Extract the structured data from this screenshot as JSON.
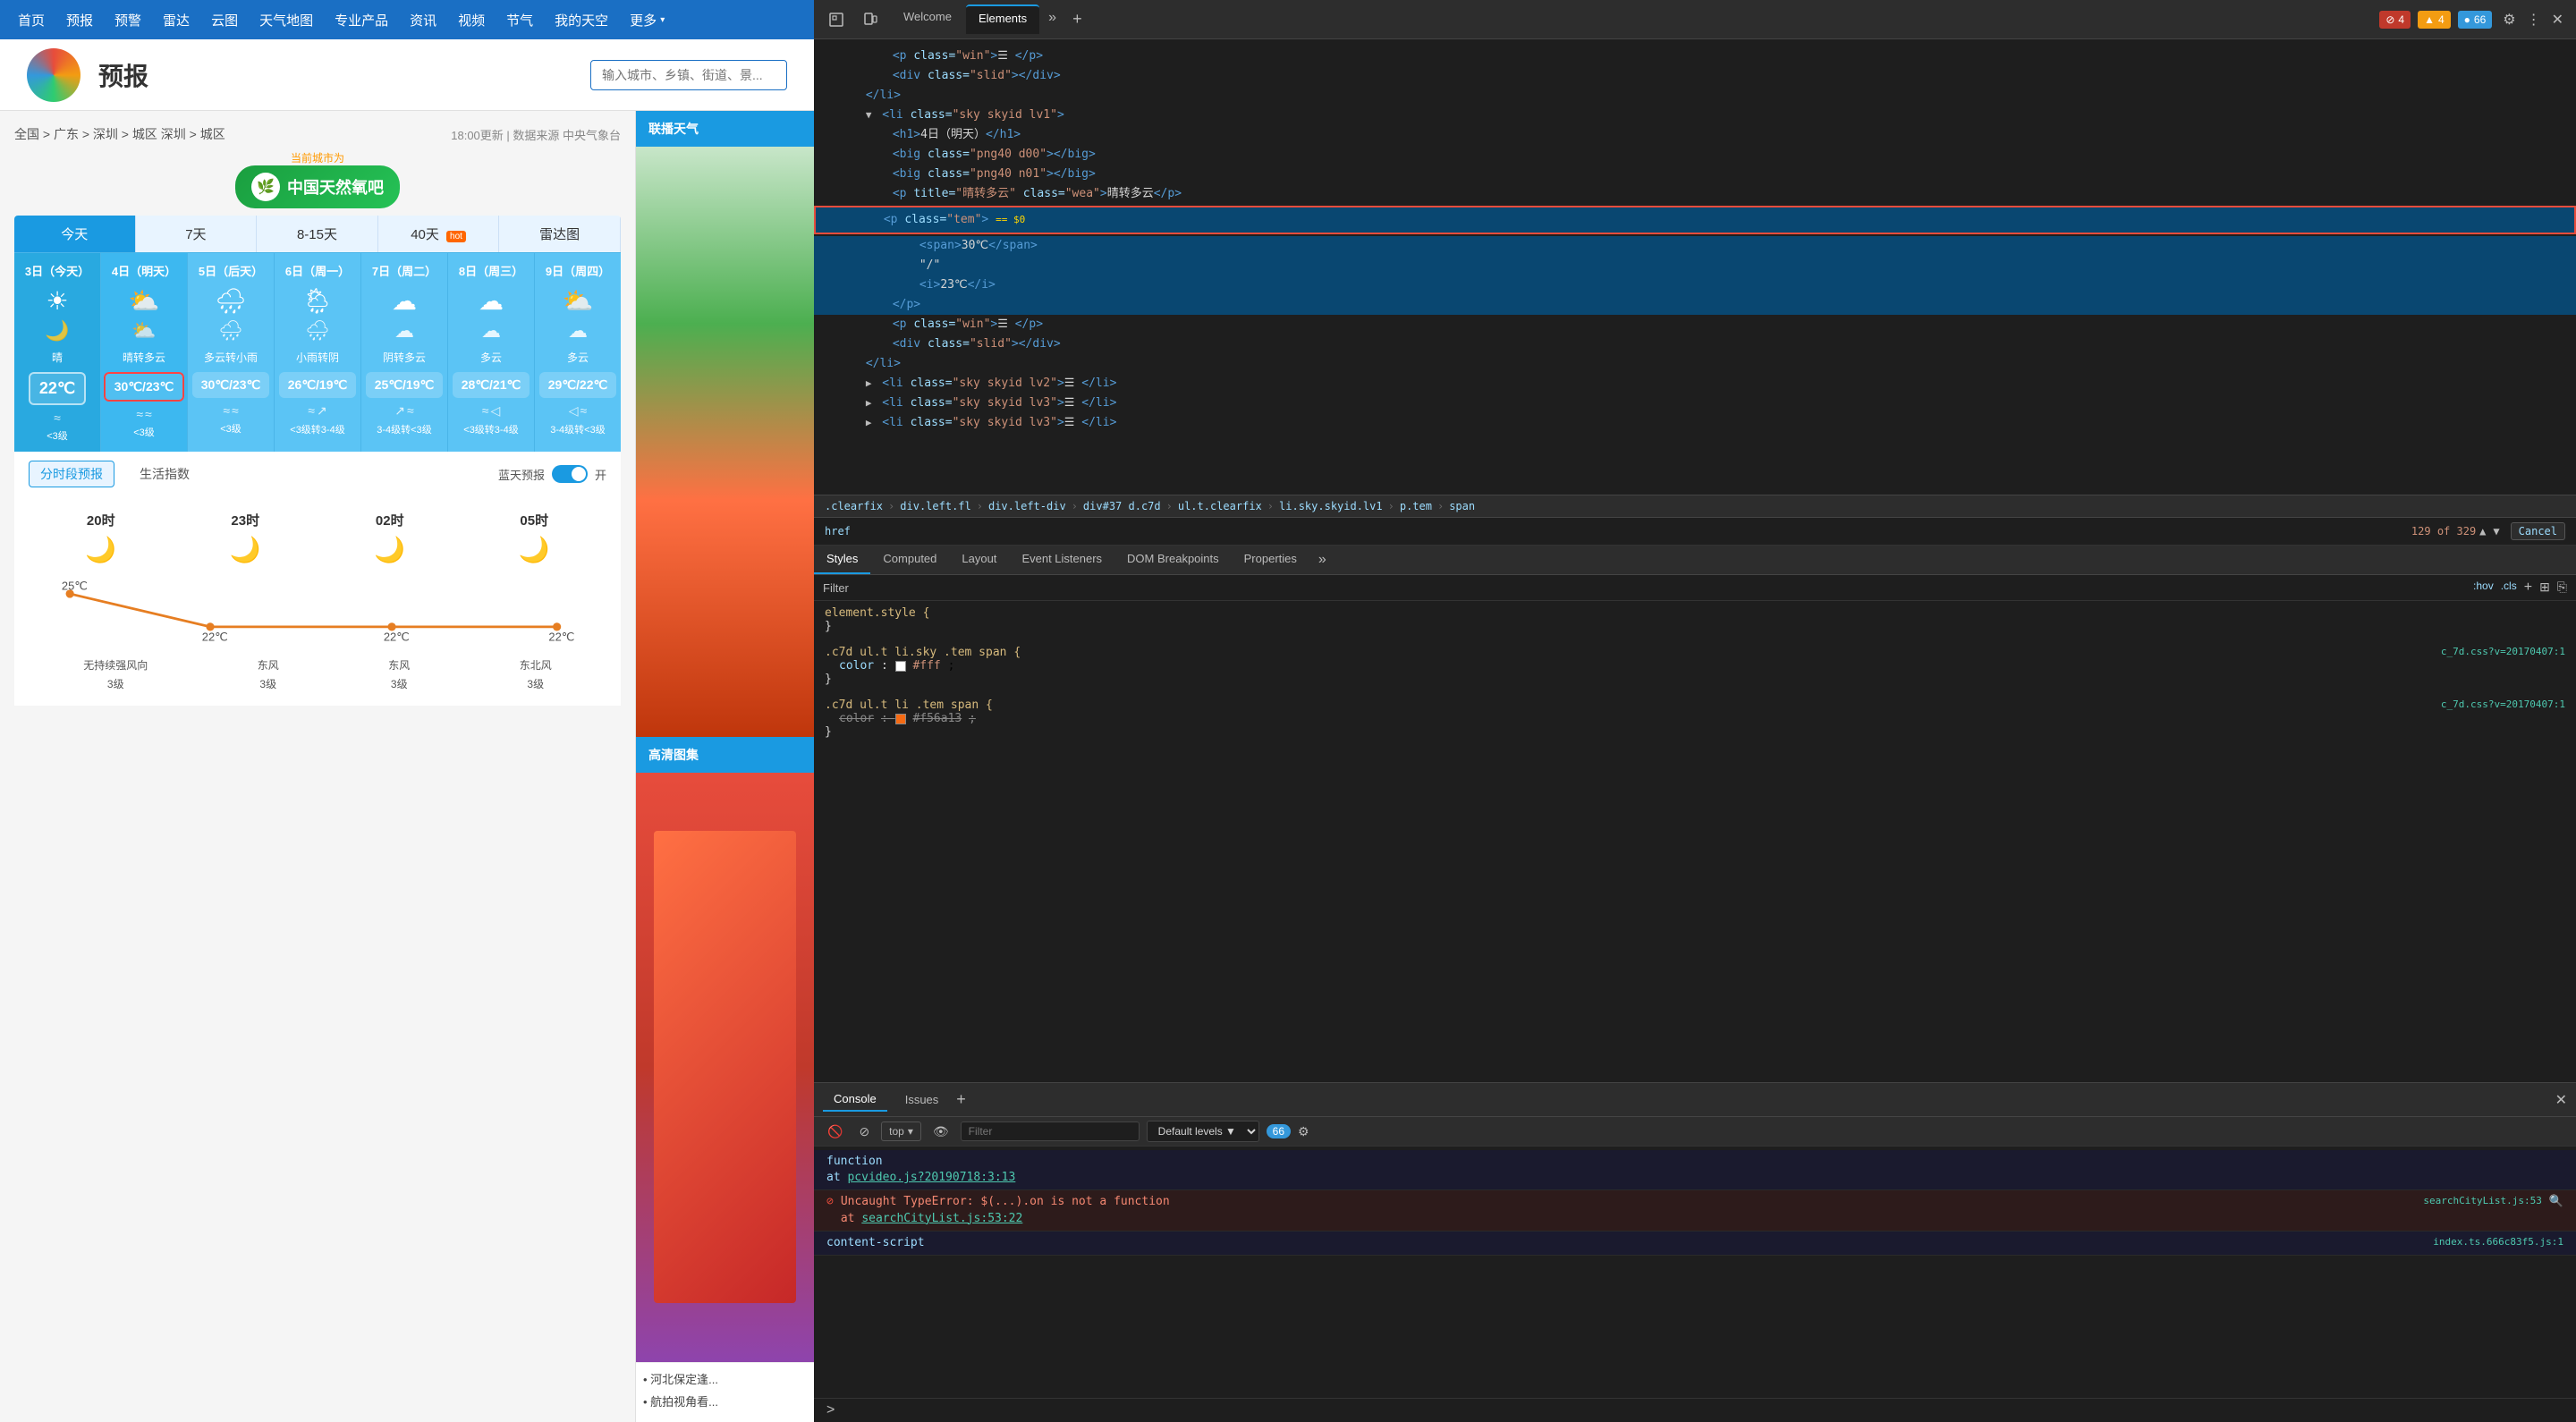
{
  "weather": {
    "nav": {
      "items": [
        "首页",
        "预报",
        "预警",
        "雷达",
        "云图",
        "天气地图",
        "专业产品",
        "资讯",
        "视频",
        "节气",
        "我的天空",
        "更多"
      ]
    },
    "header": {
      "title": "预报",
      "search_placeholder": "输入城市、乡镇、街道、景..."
    },
    "meta": {
      "breadcrumb": "全国 > 广东 > 深圳 > 城区 深圳 > 城区",
      "update_time": "18:00更新 | 数据来源 中央气象台",
      "city_label": "当前城市为",
      "city_name": "中国天然氧吧"
    },
    "tabs": [
      "今天",
      "7天",
      "8-15天",
      "40天 HOT",
      "雷达图"
    ],
    "forecast_days": [
      {
        "date": "3日（今天）",
        "day_icon": "☀",
        "night_icon": "🌙",
        "desc": "晴",
        "temp": "22℃",
        "wind_icons": [
          "≈"
        ],
        "wind_level": "<3级",
        "is_today": true
      },
      {
        "date": "4日（明天）",
        "day_icon": "⛅",
        "night_icon": "⛅",
        "desc": "晴转多云",
        "temp": "30℃/23℃",
        "wind_icons": [
          "≈",
          "≈"
        ],
        "wind_level": "<3级",
        "is_selected": true
      },
      {
        "date": "5日（后天）",
        "day_icon": "🌧",
        "night_icon": "🌧",
        "desc": "多云转小雨",
        "temp": "30℃/23℃",
        "wind_icons": [
          "≈",
          "≈"
        ],
        "wind_level": "<3级"
      },
      {
        "date": "6日（周一）",
        "day_icon": "🌦",
        "night_icon": "🌧",
        "desc": "小雨转阴",
        "temp": "26℃/19℃",
        "wind_icons": [
          "≈",
          "↗"
        ],
        "wind_level": "<3级转3-4级"
      },
      {
        "date": "7日（周二）",
        "day_icon": "☁",
        "night_icon": "☁",
        "desc": "阴转多云",
        "temp": "25℃/19℃",
        "wind_icons": [
          "↗",
          "≈"
        ],
        "wind_level": "3-4级转<3级"
      },
      {
        "date": "8日（周三）",
        "day_icon": "☁",
        "night_icon": "☁",
        "desc": "多云",
        "temp": "28℃/21℃",
        "wind_icons": [
          "≈",
          "◁"
        ],
        "wind_level": "<3级转3-4级"
      },
      {
        "date": "9日（周四）",
        "day_icon": "⛅",
        "night_icon": "☁",
        "desc": "多云",
        "temp": "29℃/22℃",
        "wind_icons": [
          "◁",
          "≈"
        ],
        "wind_level": "3-4级转<3级"
      }
    ],
    "sub_tabs": [
      "分时段预报",
      "生活指数"
    ],
    "blue_sky": "蓝天预报",
    "hourly": {
      "times": [
        "20时",
        "23时",
        "02时",
        "05时"
      ],
      "icons": [
        "🌙",
        "🌙",
        "🌙",
        "🌙"
      ],
      "temps": [
        "25℃",
        "22℃",
        "22℃",
        "22℃"
      ],
      "winds": [
        "无持续强风向",
        "东风",
        "东风",
        "东北风"
      ]
    },
    "sidebar": {
      "title": "联播天气",
      "ad_title": "高清图集"
    }
  },
  "devtools": {
    "tabs": [
      "Welcome",
      "Elements"
    ],
    "more_label": "»",
    "add_label": "+",
    "alerts": {
      "errors": "4",
      "warnings": "4",
      "info": "66"
    },
    "close_label": "✕",
    "dom": {
      "lines": [
        {
          "indent": 4,
          "content": "<p class=\"win\">☰ </p>",
          "type": "normal"
        },
        {
          "indent": 4,
          "content": "<div class=\"slid\"></div>",
          "type": "normal"
        },
        {
          "indent": 2,
          "content": "</li>",
          "type": "normal"
        },
        {
          "indent": 2,
          "content": "▼ <li class=\"sky skyid lv1\">",
          "type": "normal"
        },
        {
          "indent": 4,
          "content": "<h1>4日（明天）</h1>",
          "type": "normal"
        },
        {
          "indent": 4,
          "content": "<big class=\"png40 d00\"></big>",
          "type": "normal"
        },
        {
          "indent": 4,
          "content": "<big class=\"png40 n01\"></big>",
          "type": "normal"
        },
        {
          "indent": 4,
          "content": "<p title=\"晴转多云\" class=\"wea\">晴转多云</p>",
          "type": "normal"
        },
        {
          "indent": 4,
          "content": "<p class=\"tem\">",
          "type": "highlighted",
          "selected": true
        },
        {
          "indent": 6,
          "content": "<span>30℃</span>",
          "type": "in-highlight"
        },
        {
          "indent": 6,
          "content": "\"/\"",
          "type": "in-highlight"
        },
        {
          "indent": 6,
          "content": "<i>23℃</i>",
          "type": "in-highlight"
        },
        {
          "indent": 4,
          "content": "</p>",
          "type": "in-highlight"
        },
        {
          "indent": 4,
          "content": "<p class=\"win\">☰ </p>",
          "type": "normal"
        },
        {
          "indent": 4,
          "content": "<div class=\"slid\"></div>",
          "type": "normal"
        },
        {
          "indent": 2,
          "content": "</li>",
          "type": "normal"
        },
        {
          "indent": 2,
          "content": "▶ <li class=\"sky skyid lv2\">☰ </li>",
          "type": "normal"
        },
        {
          "indent": 2,
          "content": "▶ <li class=\"sky skyid lv3\">☰ </li>",
          "type": "normal"
        },
        {
          "indent": 2,
          "content": "▶ <li class=\"sky skyid lv3\">☰ </li>",
          "type": "normal"
        }
      ],
      "selected_hint": "== $0"
    },
    "breadcrumb": {
      "items": [
        ".clearfix",
        "div.left.fl",
        "div.left-div",
        "div#37 d.c7d",
        "ul.t.clearfix",
        "li.sky.skyid.lv1",
        "p.tem",
        "span"
      ]
    },
    "href": {
      "label": "href",
      "value": "129 of 329",
      "cancel_label": "Cancel"
    },
    "styles": {
      "tabs": [
        "Styles",
        "Computed",
        "Layout",
        "Event Listeners",
        "DOM Breakpoints",
        "Properties"
      ],
      "filter_placeholder": "Filter",
      "hov": ":hov",
      "cls": ".cls",
      "rules": [
        {
          "selector": "element.style {",
          "props": [],
          "link": "",
          "close": "}"
        },
        {
          "selector": ".c7d ul.t li.sky .tem span {",
          "props": [
            {
              "name": "color",
              "value": "#fff",
              "strikethrough": false
            }
          ],
          "link": "c_7d.css?v=20170407:1",
          "close": "}"
        },
        {
          "selector": ".c7d ul.t li .tem span {",
          "props": [
            {
              "name": "color",
              "value": "#f56a13",
              "strikethrough": true,
              "comment": "color: #f56a13;"
            }
          ],
          "link": "c_7d.css?v=20170407:1",
          "close": "}"
        }
      ]
    },
    "console": {
      "tabs": [
        "Console",
        "Issues"
      ],
      "add_label": "+",
      "filter_placeholder": "Filter",
      "default_levels": "Default levels ▼",
      "badge_count": "66",
      "messages": [
        {
          "type": "info",
          "text": "function",
          "sub_text": "at pcvideo.js?20190718:3:13",
          "link": "pcvideo.js?20190718:3:13",
          "loc": ""
        },
        {
          "type": "error",
          "icon": "●",
          "text": "Uncaught TypeError: $(...).on is not a function",
          "link_text": "searchCityList.js:53",
          "sub_text": "at searchCityList.js:53:22",
          "loc": "searchCityList.js:53"
        },
        {
          "type": "info",
          "text": "content-script",
          "loc": "index.ts.666c83f5.js:1"
        }
      ],
      "prompt_arrow": ">",
      "top_label": "top"
    }
  }
}
